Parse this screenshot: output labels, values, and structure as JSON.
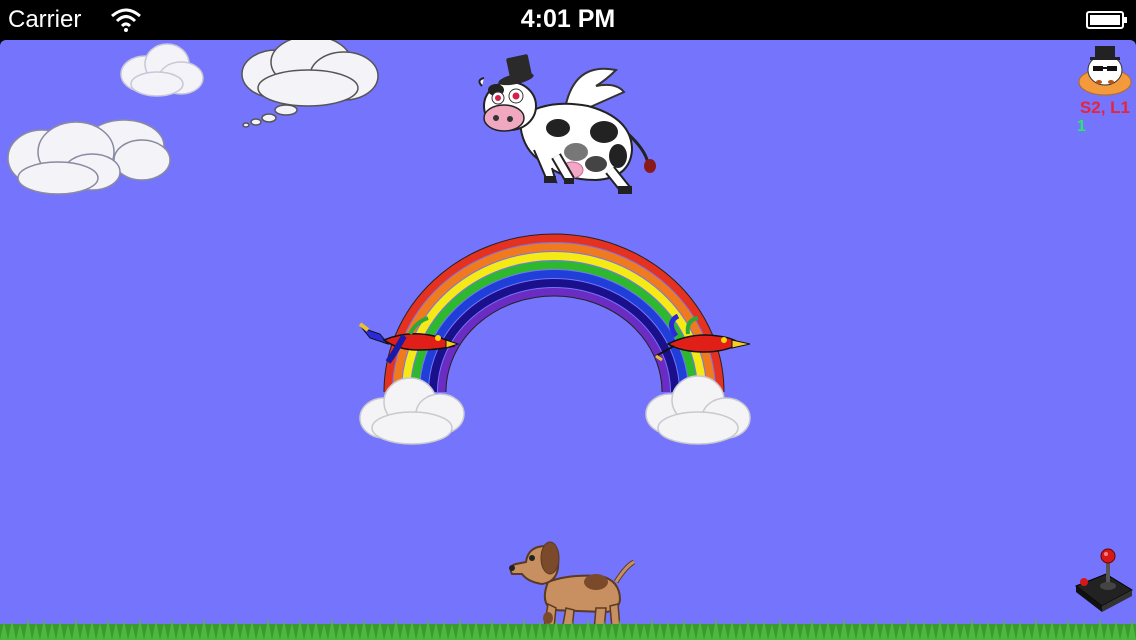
{
  "status_bar": {
    "carrier": "Carrier",
    "time": "4:01 PM",
    "wifi_icon": "wifi-icon",
    "battery_icon": "battery-icon"
  },
  "hud": {
    "status": "S2, L1",
    "count": "1",
    "status_color": "#e8243a",
    "count_color": "#28e86a",
    "avatar_icon": "cow-face-icon"
  },
  "scene": {
    "sky_color": "#7474fc",
    "grass_color": "#3fa83a",
    "characters": [
      "flying-cow",
      "dog",
      "parrot-left",
      "parrot-right"
    ],
    "controls_icon": "joystick-icon"
  }
}
